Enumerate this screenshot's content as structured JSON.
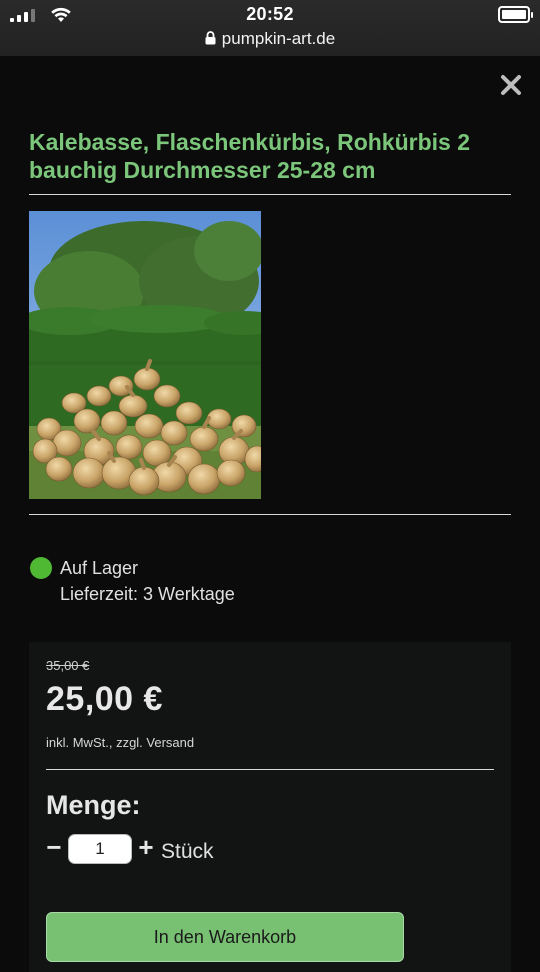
{
  "status_bar": {
    "time": "20:52",
    "url": "pumpkin-art.de",
    "icons": [
      "signal-icon",
      "wifi-icon",
      "lock-icon",
      "battery-icon"
    ]
  },
  "product": {
    "title": "Kalebasse, Flaschenkürbis, Rohkürbis 2 bauchig Durchmesser 25-28 cm",
    "image": "pile of bottle gourds on grass in front of a green hedge",
    "stock_status": "Auf Lager",
    "stock_color": "#4fb933",
    "delivery_time": "Lieferzeit: 3 Werktage"
  },
  "pricing": {
    "old_price": "35,00 €",
    "price": "25,00 €",
    "tax_note": "inkl. MwSt., zzgl. Versand"
  },
  "quantity": {
    "label": "Menge:",
    "minus": "−",
    "value": "1",
    "plus": "+",
    "unit": "Stück"
  },
  "cart_button": {
    "label": "In den Warenkorb",
    "color": "#78c172"
  },
  "close_icon": "close-icon",
  "colors": {
    "accent": "#7bc67a",
    "background": "#0b0b0b"
  }
}
